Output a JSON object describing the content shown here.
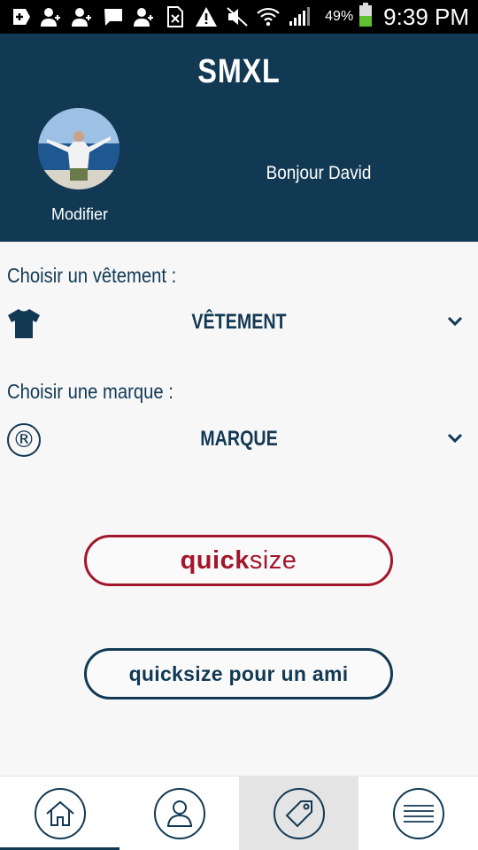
{
  "status_bar": {
    "battery_percent": "49%",
    "time": "9:39 PM",
    "icons": [
      "add-box-icon",
      "person-add-icon",
      "person-add-icon",
      "message-icon",
      "person-add-icon",
      "no-sim-icon",
      "warning-icon",
      "mute-icon",
      "wifi-icon",
      "signal-icon",
      "battery-icon"
    ]
  },
  "header": {
    "title": "SMXL",
    "modify_label": "Modifier",
    "greeting": "Bonjour David"
  },
  "clothing": {
    "label": "Choisir un vêtement :",
    "value": "VÊTEMENT",
    "icon": "tshirt-icon"
  },
  "brand": {
    "label": "Choisir une marque :",
    "value": "MARQUE",
    "icon": "registered-icon",
    "icon_glyph": "®"
  },
  "buttons": {
    "quicksize_bold": "quick",
    "quicksize_light": "size",
    "friend": "quicksize pour un ami"
  },
  "bottom_nav": {
    "items": [
      "home-icon",
      "profile-icon",
      "tag-icon",
      "menu-icon"
    ],
    "active_index": 0,
    "highlighted_index": 2
  },
  "colors": {
    "primary": "#123954",
    "accent": "#a4162b",
    "background": "#f7f7f8"
  }
}
